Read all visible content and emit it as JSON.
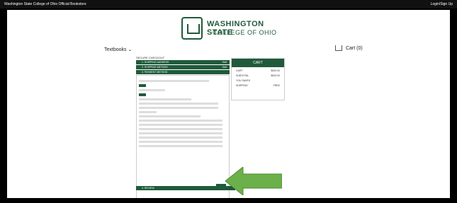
{
  "topbar": {
    "title": "Washington State College of Ohio Official Bookstore",
    "login": "Login/Sign Up"
  },
  "brand": {
    "line1": "WASHINGTON STATE",
    "line2": "COLLEGE OF OHIO",
    "color": "#1f5a3b"
  },
  "nav": {
    "textbooks": "Textbooks"
  },
  "cart_link": {
    "label": "Cart (0)"
  },
  "checkout": {
    "title": "SECURE CHECKOUT",
    "steps": [
      {
        "label": "1. SHIPPING ADDRESS",
        "action": "Edit"
      },
      {
        "label": "2. SHIPPING METHOD",
        "action": "Edit"
      },
      {
        "label": "3. PAYMENT METHOD",
        "action": ""
      }
    ],
    "review_label": "4. REVIEW"
  },
  "cart_summary": {
    "title": "CART",
    "rows": [
      {
        "label": "CART",
        "value": "$000.00"
      },
      {
        "label": "SUBTOTAL",
        "value": "$000.00"
      },
      {
        "label": "YOU SAVED",
        "value": ""
      },
      {
        "label": "SHIPPING",
        "value": "FREE"
      }
    ]
  }
}
